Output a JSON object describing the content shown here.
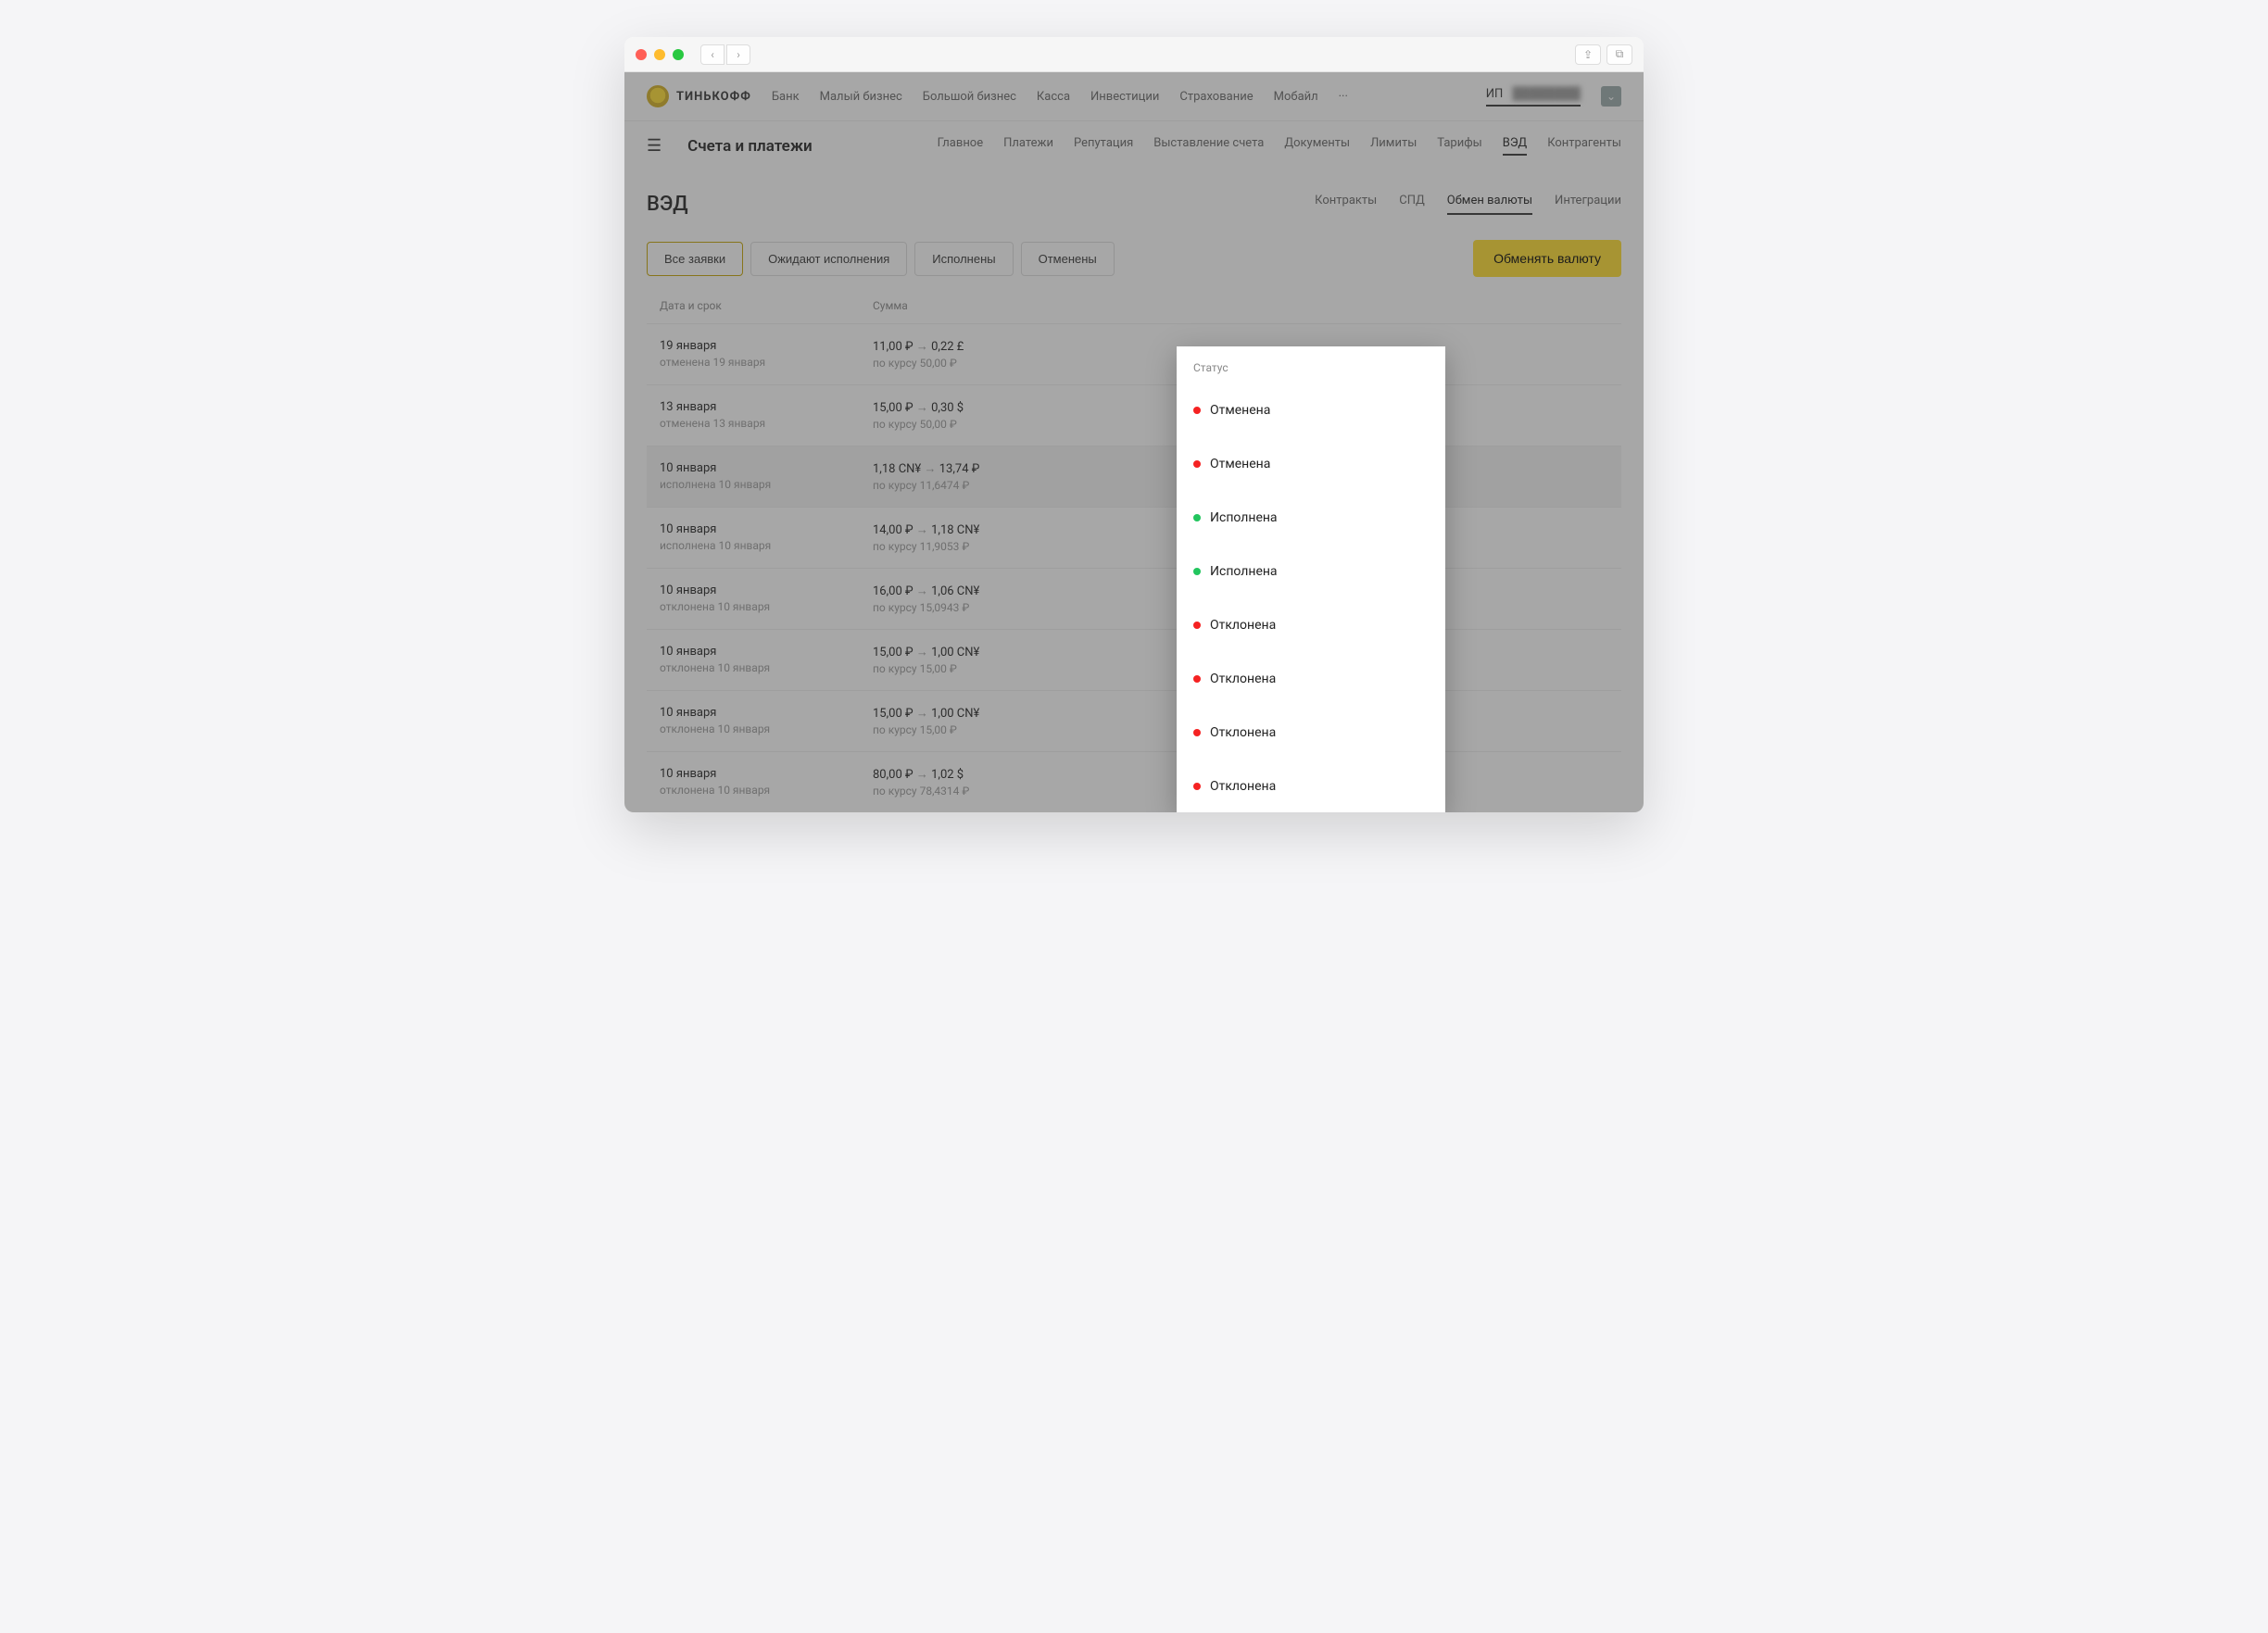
{
  "topnav": {
    "brand": "ТИНЬКОФФ",
    "items": [
      "Банк",
      "Малый бизнес",
      "Большой бизнес",
      "Касса",
      "Инвестиции",
      "Страхование",
      "Мобайл"
    ],
    "more": "···",
    "user_prefix": "ИП",
    "user_name": "████████"
  },
  "subnav": {
    "title": "Счета и платежи",
    "tabs": [
      "Главное",
      "Платежи",
      "Репутация",
      "Выставление счета",
      "Документы",
      "Лимиты",
      "Тарифы",
      "ВЭД",
      "Контрагенты"
    ],
    "active": "ВЭД"
  },
  "page": {
    "title": "ВЭД",
    "subtabs": [
      "Контракты",
      "СПД",
      "Обмен валюты",
      "Интеграции"
    ],
    "subtab_active": "Обмен валюты",
    "filters": [
      "Все заявки",
      "Ожидают исполнения",
      "Исполнены",
      "Отменены"
    ],
    "filter_active": "Все заявки",
    "cta": "Обменять валюту"
  },
  "table": {
    "head": {
      "date": "Дата и срок",
      "sum": "Сумма",
      "status": "Статус"
    },
    "rows": [
      {
        "d1": "19 января",
        "d2": "отменена 19 января",
        "from": "11,00 ₽",
        "to": "0,22 £",
        "rate": "по курсу 50,00 ₽",
        "status": "Отменена",
        "color": "red",
        "hl": false
      },
      {
        "d1": "13 января",
        "d2": "отменена 13 января",
        "from": "15,00 ₽",
        "to": "0,30 $",
        "rate": "по курсу 50,00 ₽",
        "status": "Отменена",
        "color": "red",
        "hl": false
      },
      {
        "d1": "10 января",
        "d2": "исполнена 10 января",
        "from": "1,18 CN¥",
        "to": "13,74 ₽",
        "rate": "по курсу 11,6474 ₽",
        "status": "Исполнена",
        "color": "green",
        "hl": true
      },
      {
        "d1": "10 января",
        "d2": "исполнена 10 января",
        "from": "14,00 ₽",
        "to": "1,18 CN¥",
        "rate": "по курсу 11,9053 ₽",
        "status": "Исполнена",
        "color": "green",
        "hl": false
      },
      {
        "d1": "10 января",
        "d2": "отклонена 10 января",
        "from": "16,00 ₽",
        "to": "1,06 CN¥",
        "rate": "по курсу 15,0943 ₽",
        "status": "Отклонена",
        "color": "red",
        "hl": false
      },
      {
        "d1": "10 января",
        "d2": "отклонена 10 января",
        "from": "15,00 ₽",
        "to": "1,00 CN¥",
        "rate": "по курсу 15,00 ₽",
        "status": "Отклонена",
        "color": "red",
        "hl": false
      },
      {
        "d1": "10 января",
        "d2": "отклонена 10 января",
        "from": "15,00 ₽",
        "to": "1,00 CN¥",
        "rate": "по курсу 15,00 ₽",
        "status": "Отклонена",
        "color": "red",
        "hl": false
      },
      {
        "d1": "10 января",
        "d2": "отклонена 10 января",
        "from": "80,00 ₽",
        "to": "1,02 $",
        "rate": "по курсу 78,4314 ₽",
        "status": "Отклонена",
        "color": "red",
        "hl": false
      }
    ]
  }
}
